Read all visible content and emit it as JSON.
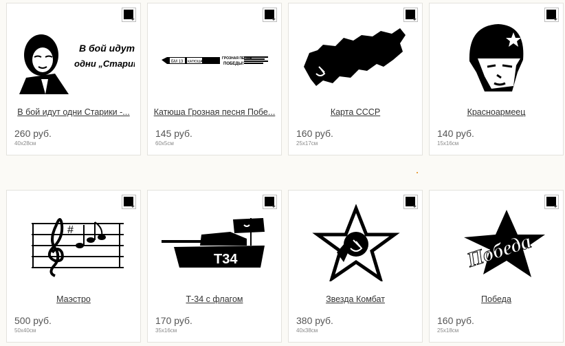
{
  "products": [
    {
      "title": "В бой идут одни Старики -...",
      "price": "260 руб.",
      "size": "40x28см",
      "art_text": [
        "В бой идут",
        "одни „Старики\""
      ]
    },
    {
      "title": "Катюша Грозная песня Побе...",
      "price": "145 руб.",
      "size": "60x5см",
      "art_text": [
        "БМ 13",
        "КАТЮША",
        "ГРОЗНАЯ ПЕСНЯ",
        "ПОБЕДЫ!"
      ]
    },
    {
      "title": "Карта СССР",
      "price": "160 руб.",
      "size": "25x17см"
    },
    {
      "title": "Красноармеец",
      "price": "140 руб.",
      "size": "15x16см"
    },
    {
      "title": "Маэстро",
      "price": "500 руб.",
      "size": "50x40см"
    },
    {
      "title": "Т-34 с флагом",
      "price": "170 руб.",
      "size": "35x16см",
      "art_text": [
        "Т34"
      ]
    },
    {
      "title": "Звезда Комбат",
      "price": "380 руб.",
      "size": "40x38см"
    },
    {
      "title": "Победа",
      "price": "160 руб.",
      "size": "25x18см",
      "art_text": [
        "Победа"
      ]
    }
  ],
  "colors": {
    "sticker": "#000000",
    "link": "#333333"
  }
}
